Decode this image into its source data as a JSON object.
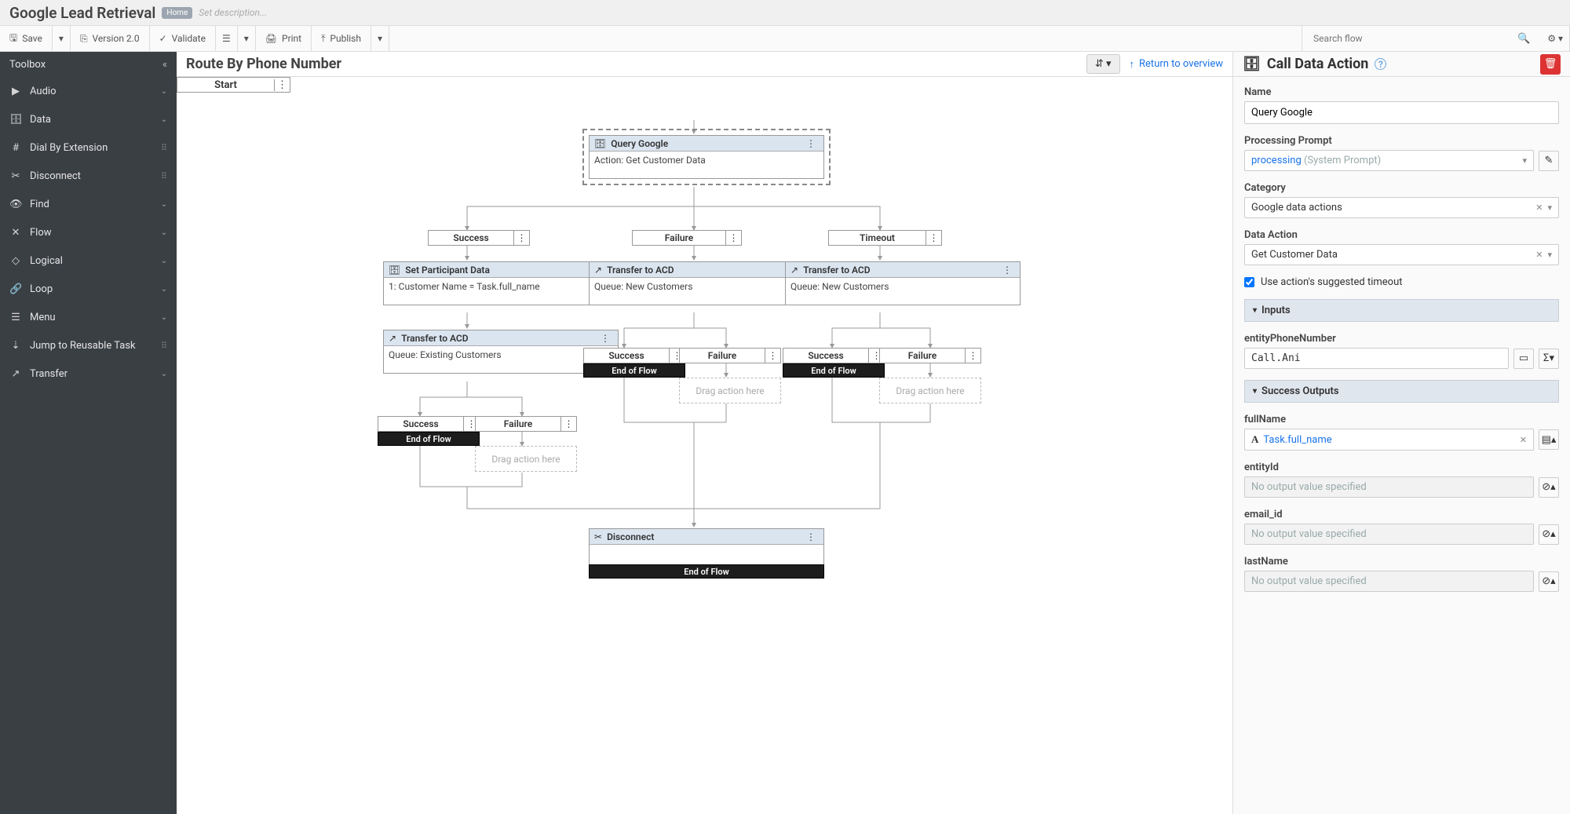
{
  "header": {
    "title": "Google Lead Retrieval",
    "badge": "Home",
    "desc_placeholder": "Set description..."
  },
  "toolbar": {
    "save": "Save",
    "version": "Version 2.0",
    "validate": "Validate",
    "print": "Print",
    "publish": "Publish",
    "search_ph": "Search flow"
  },
  "sidebar": {
    "title": "Toolbox",
    "items": [
      {
        "icon": "▶",
        "label": "Audio",
        "kind": "group"
      },
      {
        "icon": "🗄",
        "label": "Data",
        "kind": "group"
      },
      {
        "icon": "#",
        "label": "Dial By Extension",
        "kind": "item"
      },
      {
        "icon": "✂",
        "label": "Disconnect",
        "kind": "item"
      },
      {
        "icon": "👁",
        "label": "Find",
        "kind": "group"
      },
      {
        "icon": "✕",
        "label": "Flow",
        "kind": "group"
      },
      {
        "icon": "◇",
        "label": "Logical",
        "kind": "group"
      },
      {
        "icon": "🔗",
        "label": "Loop",
        "kind": "group"
      },
      {
        "icon": "☰",
        "label": "Menu",
        "kind": "group"
      },
      {
        "icon": "⇣",
        "label": "Jump to Reusable Task",
        "kind": "item"
      },
      {
        "icon": "↗",
        "label": "Transfer",
        "kind": "group"
      }
    ]
  },
  "canvas": {
    "title": "Route By Phone Number",
    "return_link": "Return to overview",
    "start_label": "Start",
    "end_of_flow": "End of Flow",
    "drag_here": "Drag action here",
    "branches": {
      "success": "Success",
      "failure": "Failure",
      "timeout": "Timeout"
    },
    "nodes": {
      "query_google": {
        "title": "Query Google",
        "body": "Action: Get Customer Data"
      },
      "set_participant": {
        "title": "Set Participant Data",
        "body": "1: Customer Name = Task.full_name"
      },
      "transfer_existing": {
        "title": "Transfer to ACD",
        "body": "Queue: Existing Customers"
      },
      "transfer_new_a": {
        "title": "Transfer to ACD",
        "body": "Queue: New Customers"
      },
      "transfer_new_b": {
        "title": "Transfer to ACD",
        "body": "Queue: New Customers"
      },
      "disconnect": {
        "title": "Disconnect"
      }
    }
  },
  "panel": {
    "title": "Call Data Action",
    "name_label": "Name",
    "name_value": "Query Google",
    "prompt_label": "Processing Prompt",
    "prompt_value": "processing",
    "prompt_suffix": "(System Prompt)",
    "category_label": "Category",
    "category_value": "Google data actions",
    "action_label": "Data Action",
    "action_value": "Get Customer Data",
    "timeout_label": "Use action's suggested timeout",
    "inputs_title": "Inputs",
    "inputs": {
      "entityPhoneNumber_label": "entityPhoneNumber",
      "entityPhoneNumber_value": "Call.Ani"
    },
    "outputs_title": "Success Outputs",
    "outputs": {
      "fullName_label": "fullName",
      "fullName_value": "Task.full_name",
      "entityId_label": "entityId",
      "entityId_value": "No output value specified",
      "email_label": "email_id",
      "email_value": "No output value specified",
      "lastName_label": "lastName",
      "lastName_value": "No output value specified"
    }
  }
}
